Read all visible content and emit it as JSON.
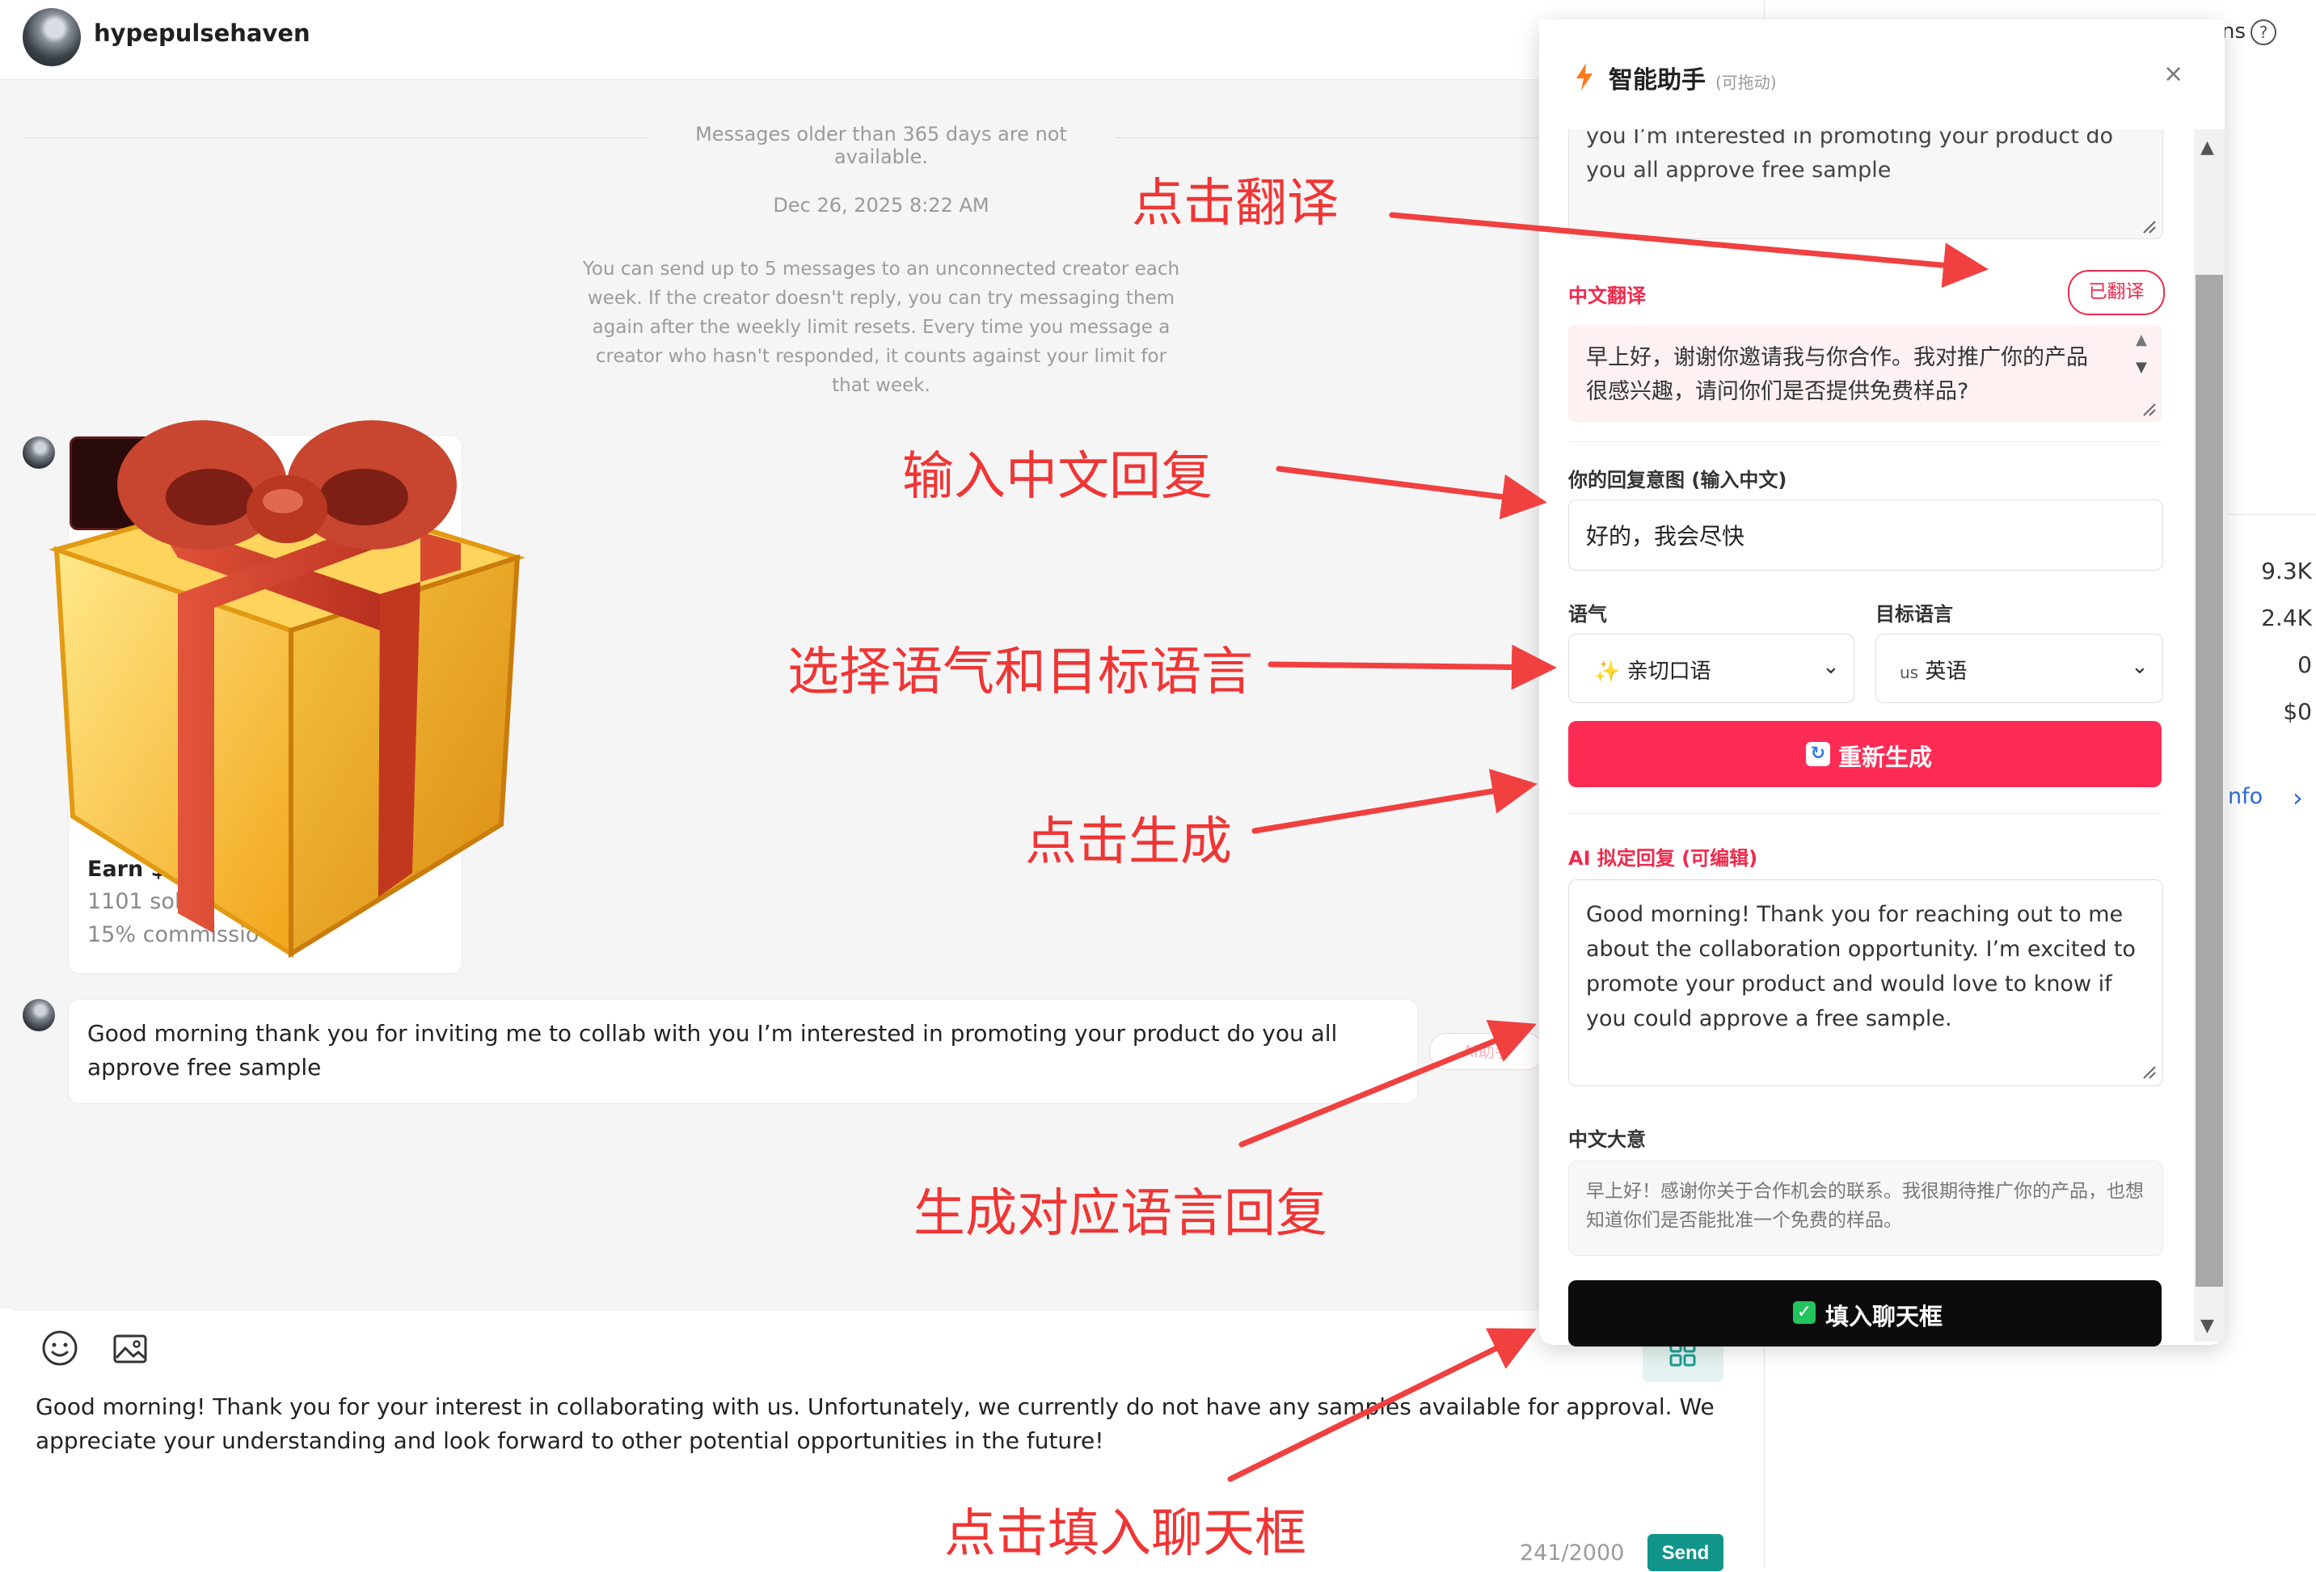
{
  "header": {
    "username": "hypepulsehaven"
  },
  "chat": {
    "older_note": "Messages older than 365 days are not available.",
    "date": "Dec 26, 2025 8:22 AM",
    "limit_note": "You can send up to 5 messages to an unconnected creator each week. If the creator doesn't reply, you can try messaging them again after the weekly limit resets. Every time you message a creator who hasn't responded, it counts against your limit for that week.",
    "product": {
      "title": "Earn $",
      "sold": "1101 sold",
      "commission": "15% commissio"
    },
    "message": "Good morning thank you for inviting me to collab with you I’m interested in promoting your product do you all approve free sample",
    "ai_chip": "AI助手"
  },
  "composer": {
    "text": "Good morning! Thank you for your interest in collaborating with us. Unfortunately, we currently do not have any samples available for approval. We appreciate your understanding and look forward to other potential opportunities in the future!",
    "char_count": "241/2000",
    "send_label": "Send"
  },
  "right_column": {
    "partial_label": "ns",
    "help": "?",
    "stats": [
      "9.3K",
      "2.4K",
      "0",
      "$0"
    ],
    "info_link": "nfo",
    "chevron": "›"
  },
  "assistant": {
    "title": "智能助手",
    "subtitle": "(可拖动)",
    "close": "×",
    "original_text": "you I’m interested in promoting your product do you all approve free sample",
    "cn_label": "中文翻译",
    "translated_btn": "已翻译",
    "cn_text": "早上好，谢谢你邀请我与你合作。我对推广你的产品很感兴趣，请问你们是否提供免费样品?",
    "intent_label": "你的回复意图 (输入中文)",
    "intent_value": "好的，我会尽快",
    "tone_label": "语气",
    "tone_value": "亲切口语",
    "lang_label": "目标语言",
    "lang_value": "英语",
    "lang_code": "us",
    "regen_label": "重新生成",
    "ai_label": "AI 拟定回复 (可编辑)",
    "ai_text": "Good morning! Thank you for reaching out to me about the collaboration opportunity. I’m excited to promote your product and would love to know if you could approve a free sample.",
    "gist_label": "中文大意",
    "gist_text": "早上好！感谢你关于合作机会的联系。我很期待推广你的产品，也想知道你们是否能批准一个免费的样品。",
    "fill_label": "填入聊天框"
  },
  "annotations": {
    "click_translate": "点击翻译",
    "input_reply": "输入中文回复",
    "select_tone_lang": "选择语气和目标语言",
    "click_generate": "点击生成",
    "generate_reply": "生成对应语言回复",
    "click_fill": "点击填入聊天框"
  },
  "colors": {
    "accent": "#fe2c55",
    "send": "#11958a",
    "annotation": "#f03535",
    "fill_button": "#0c0c0c"
  }
}
